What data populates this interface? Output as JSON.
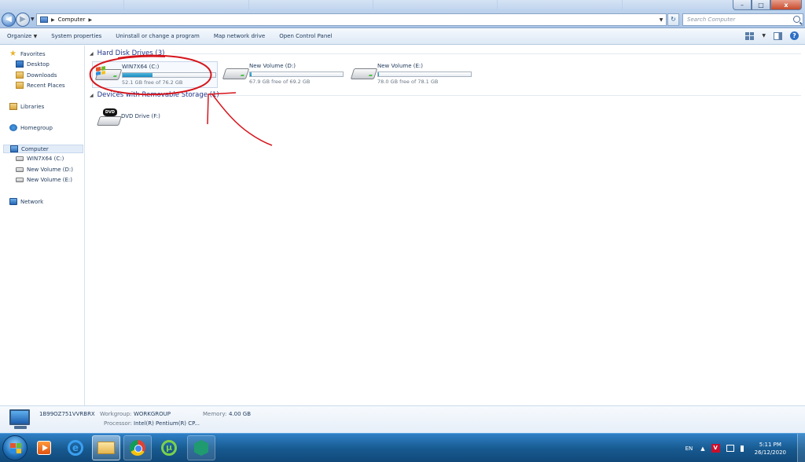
{
  "address_bar": {
    "path_segment": "Computer",
    "search_placeholder": "Search Computer"
  },
  "window_controls": {
    "minimize": "–",
    "maximize": "□",
    "close": "x"
  },
  "toolbar": {
    "organize": "Organize",
    "system_properties": "System properties",
    "uninstall": "Uninstall or change a program",
    "map_drive": "Map network drive",
    "control_panel": "Open Control Panel"
  },
  "sidebar": {
    "favorites": "Favorites",
    "desktop": "Desktop",
    "downloads": "Downloads",
    "recent": "Recent Places",
    "libraries": "Libraries",
    "homegroup": "Homegroup",
    "computer": "Computer",
    "drive_c": "WIN7X64 (C:)",
    "drive_d": "New Volume (D:)",
    "drive_e": "New Volume (E:)",
    "network": "Network"
  },
  "groups": {
    "hard_disks": "Hard Disk Drives (3)",
    "removable": "Devices with Removable Storage (1)"
  },
  "drives": [
    {
      "name": "WIN7X64 (C:)",
      "free_text": "52.1 GB free of 76.2 GB",
      "used_fraction": 0.32
    },
    {
      "name": "New Volume (D:)",
      "free_text": "67.9 GB free of 69.2 GB",
      "used_fraction": 0.02
    },
    {
      "name": "New Volume (E:)",
      "free_text": "78.0 GB free of 78.1 GB",
      "used_fraction": 0.01
    }
  ],
  "dvd": {
    "name": "DVD Drive (F:)",
    "logo": "DVD"
  },
  "details": {
    "computer_name": "1B99OZ751VVRBRX",
    "workgroup_label": "Workgroup:",
    "workgroup_value": "WORKGROUP",
    "memory_label": "Memory:",
    "memory_value": "4.00 GB",
    "processor_label": "Processor:",
    "processor_value": "Intel(R) Pentium(R) CP..."
  },
  "taskbar": {
    "lang": "EN",
    "time": "5:11 PM",
    "date": "26/12/2020"
  },
  "colors": {
    "annotation": "#d6151c",
    "accent": "#1e3287",
    "taskbar": "#17598f"
  }
}
